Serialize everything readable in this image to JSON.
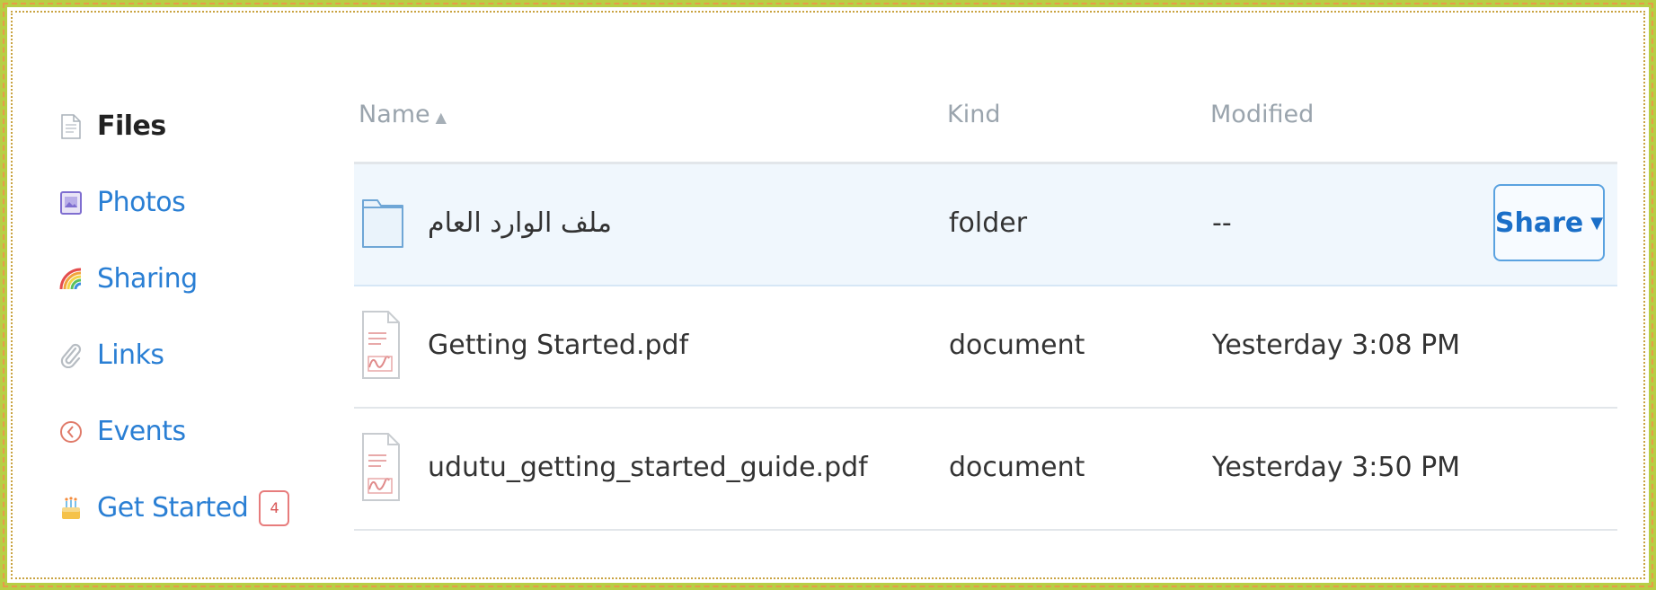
{
  "sidebar": {
    "items": [
      {
        "label": "Files",
        "icon": "file-icon",
        "active": true
      },
      {
        "label": "Photos",
        "icon": "photo-icon"
      },
      {
        "label": "Sharing",
        "icon": "rainbow-icon"
      },
      {
        "label": "Links",
        "icon": "paperclip-icon"
      },
      {
        "label": "Events",
        "icon": "clock-icon"
      },
      {
        "label": "Get Started",
        "icon": "cake-icon",
        "badge": "4"
      }
    ]
  },
  "table": {
    "headers": {
      "name": "Name",
      "sort_indicator": "▲",
      "kind": "Kind",
      "modified": "Modified"
    },
    "rows": [
      {
        "name": "ملف الوارد العام",
        "kind": "folder",
        "modified": "--",
        "icon": "folder-icon",
        "selected": true,
        "action": "Share",
        "action_caret": "▼"
      },
      {
        "name": "Getting Started.pdf",
        "kind": "document",
        "modified": "Yesterday 3:08 PM",
        "icon": "pdf-icon"
      },
      {
        "name": "udutu_getting_started_guide.pdf",
        "kind": "document",
        "modified": "Yesterday 3:50 PM",
        "icon": "pdf-icon"
      }
    ]
  },
  "colors": {
    "link": "#2a7fd4",
    "border": "#b7cf45",
    "selected_row": "#f0f7fd",
    "badge": "#e77c7c"
  }
}
